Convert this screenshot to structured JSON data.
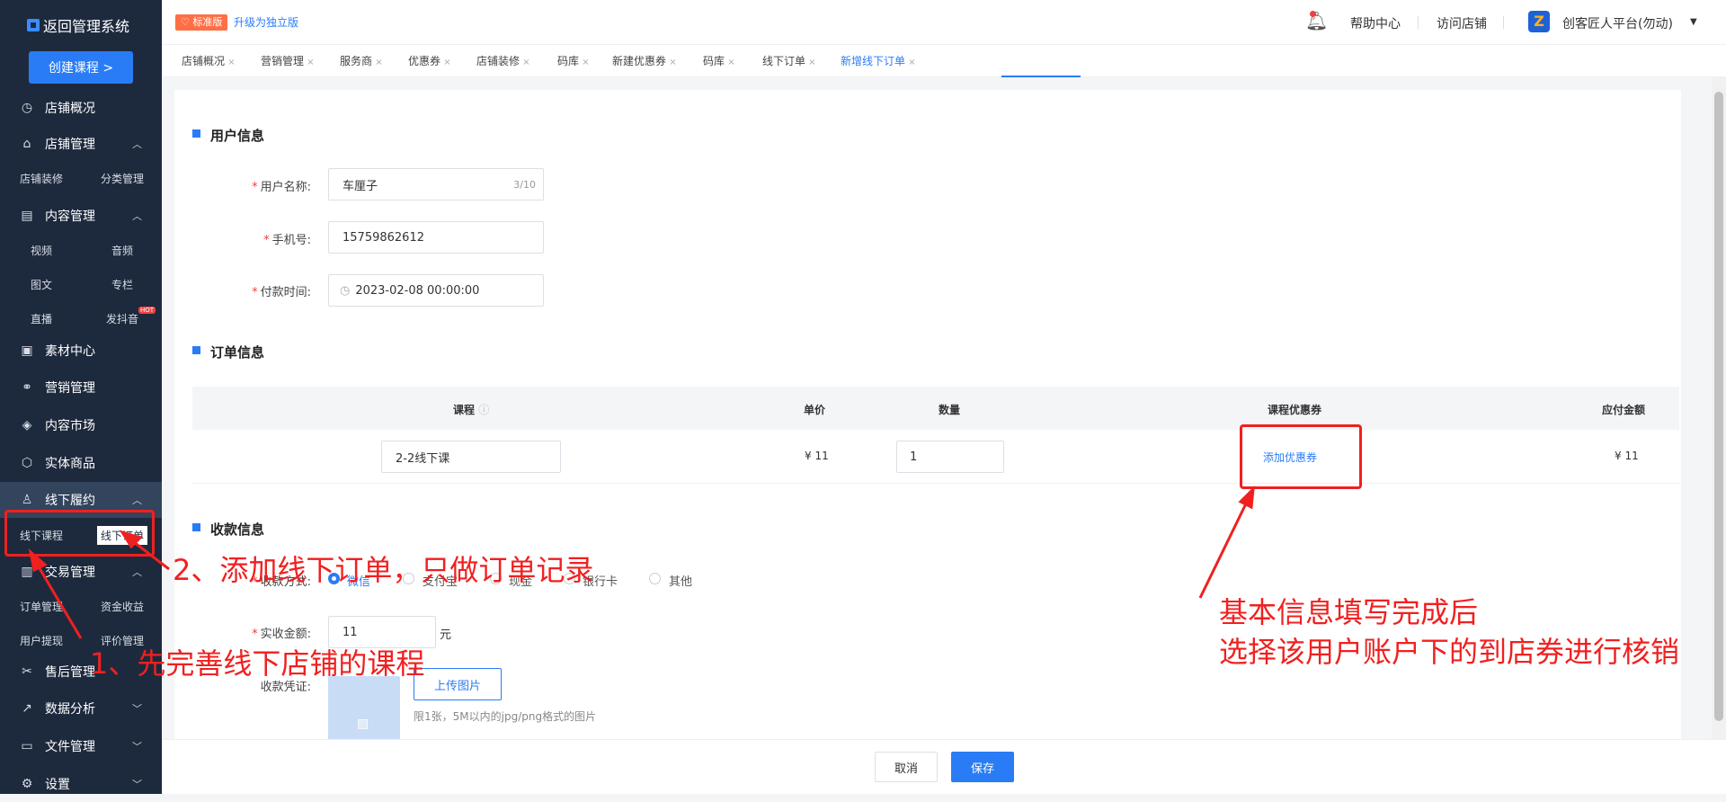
{
  "sidebar": {
    "brand": "返回管理系统",
    "create_button": "创建课程 >",
    "items": {
      "overview": "店铺概况",
      "shop_manage": "店铺管理",
      "shop_decor": "店铺装修",
      "category": "分类管理",
      "content": "内容管理",
      "video": "视频",
      "audio": "音频",
      "article": "图文",
      "column": "专栏",
      "live": "直播",
      "douyin": "发抖音",
      "hot": "HOT",
      "material": "素材中心",
      "marketing": "营销管理",
      "market": "内容市场",
      "goods": "实体商品",
      "offline": "线下履约",
      "offline_course": "线下课程",
      "offline_order": "线下订单",
      "trade": "交易管理",
      "order_manage": "订单管理",
      "fund": "资金收益",
      "withdraw": "用户提现",
      "review": "评价管理",
      "after_sale": "售后管理",
      "analytics": "数据分析",
      "files": "文件管理",
      "settings": "设置"
    }
  },
  "topbar": {
    "badge": "标准版",
    "upgrade": "升级为独立版",
    "help": "帮助中心",
    "visit": "访问店铺",
    "logo_glyph": "Z",
    "account": "创客匠人平台(勿动)"
  },
  "tabs": [
    "店铺概况",
    "营销管理",
    "服务商",
    "优惠券",
    "店铺装修",
    "码库",
    "新建优惠券",
    "码库",
    "线下订单",
    "新增线下订单"
  ],
  "form": {
    "user_section": "用户信息",
    "username_label": "用户名称:",
    "username_value": "车厘子",
    "username_count": "3/10",
    "phone_label": "手机号:",
    "phone_value": "15759862612",
    "paytime_label": "付款时间:",
    "paytime_value": "2023-02-08 00:00:00",
    "order_section": "订单信息",
    "table_headers": {
      "course": "课程",
      "price": "单价",
      "qty": "数量",
      "coupon": "课程优惠券",
      "payable": "应付金额"
    },
    "row": {
      "course": "2-2线下课",
      "price": "¥ 11",
      "qty": "1",
      "coupon": "添加优惠券",
      "payable": "¥ 11"
    },
    "pay_section": "收款信息",
    "method_label": "收款方式:",
    "methods": [
      "微信",
      "支付宝",
      "现金",
      "银行卡",
      "其他"
    ],
    "amount_label": "实收金额:",
    "amount_value": "11",
    "amount_unit": "元",
    "proof_label": "收款凭证:",
    "upload": "上传图片",
    "upload_hint": "限1张，5M以内的jpg/png格式的图片"
  },
  "footer": {
    "cancel": "取消",
    "save": "保存"
  },
  "annotations": {
    "step2": "2、添加线下订单，只做订单记录",
    "step1": "1、先完善线下店铺的课程",
    "note_line1": "基本信息填写完成后",
    "note_line2": "选择该用户账户下的到店券进行核销",
    "color": "#f02020"
  }
}
